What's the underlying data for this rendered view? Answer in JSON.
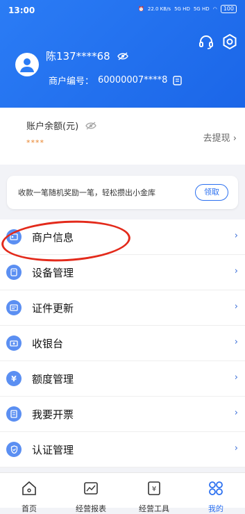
{
  "status": {
    "time": "13:00",
    "net_speed": "22.0 KB/s",
    "net_1": "5G HD",
    "net_2": "5G HD",
    "battery": "100"
  },
  "header": {
    "name_masked": "陈137****68",
    "merchant_label": "商户编号：",
    "merchant_no": "60000007****8"
  },
  "balance": {
    "label": "账户余额(元)",
    "value": "****",
    "withdraw": "去提现 ›"
  },
  "promo": {
    "text": "收款一笔随机奖励一笔，轻松攒出小金库",
    "button": "领取"
  },
  "menu": {
    "items": [
      {
        "label": "商户信息",
        "icon": "merchant-info-icon"
      },
      {
        "label": "设备管理",
        "icon": "device-icon"
      },
      {
        "label": "证件更新",
        "icon": "id-card-icon"
      },
      {
        "label": "收银台",
        "icon": "cashier-icon"
      },
      {
        "label": "额度管理",
        "icon": "yuan-icon"
      },
      {
        "label": "我要开票",
        "icon": "invoice-icon"
      },
      {
        "label": "认证管理",
        "icon": "shield-icon"
      }
    ],
    "chevron": "›"
  },
  "tabbar": {
    "items": [
      {
        "label": "首页",
        "icon": "home-icon"
      },
      {
        "label": "经营报表",
        "icon": "report-icon"
      },
      {
        "label": "经营工具",
        "icon": "tools-icon"
      },
      {
        "label": "我的",
        "icon": "mine-icon"
      }
    ]
  },
  "colors": {
    "primary": "#1f6ef0",
    "accent": "#2a6ff0",
    "annotation": "#e32a1b"
  }
}
